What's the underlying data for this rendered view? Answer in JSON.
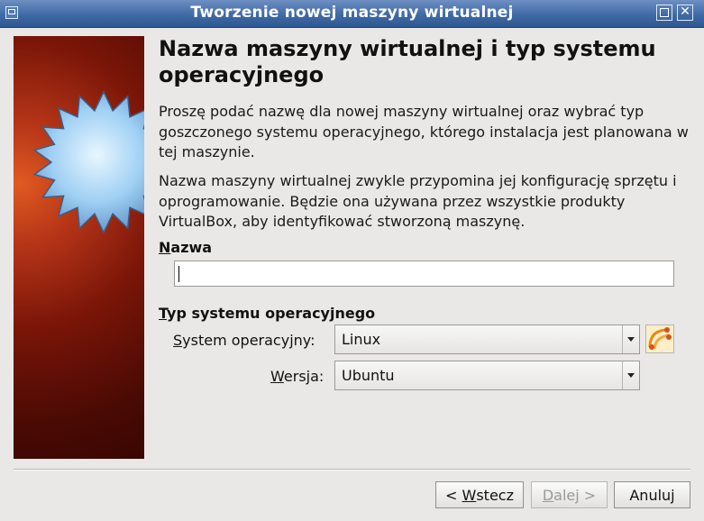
{
  "window": {
    "title": "Tworzenie nowej maszyny wirtualnej",
    "icon": "virtualbox-app-icon",
    "controls": [
      "maximize",
      "close"
    ]
  },
  "page": {
    "heading": "Nazwa maszyny wirtualnej i typ systemu operacyjnego",
    "paragraph1": "Proszę podać nazwę dla nowej maszyny wirtualnej oraz wybrać typ goszczonego systemu operacyjnego, którego instalacja jest planowana w tej maszynie.",
    "paragraph2": "Nazwa maszyny wirtualnej zwykle przypomina jej konfigurację sprzętu i oprogramowanie. Będzie ona używana przez wszystkie produkty VirtualBox, aby identyfikować stworzoną maszynę."
  },
  "name_section": {
    "label_hotkey": "N",
    "label_rest": "azwa",
    "value": ""
  },
  "os_section": {
    "label_hotkey": "T",
    "label_rest": "yp systemu operacyjnego",
    "os_label_hotkey": "S",
    "os_label_rest": "ystem operacyjny:",
    "os_value": "Linux",
    "version_label_hotkey": "W",
    "version_label_rest": "ersja:",
    "version_value": "Ubuntu",
    "os_icon": "ubuntu-os-icon"
  },
  "buttons": {
    "back_prefix": "< ",
    "back_hotkey": "W",
    "back_rest": "stecz",
    "next_hotkey": "D",
    "next_rest": "alej >",
    "cancel": "Anuluj",
    "next_enabled": false
  },
  "colors": {
    "titlebar": "#3f6aa6",
    "sidebar_red": "#7a1508",
    "star_blue": "#8fc4ef",
    "window_bg": "#e9e8e6"
  }
}
